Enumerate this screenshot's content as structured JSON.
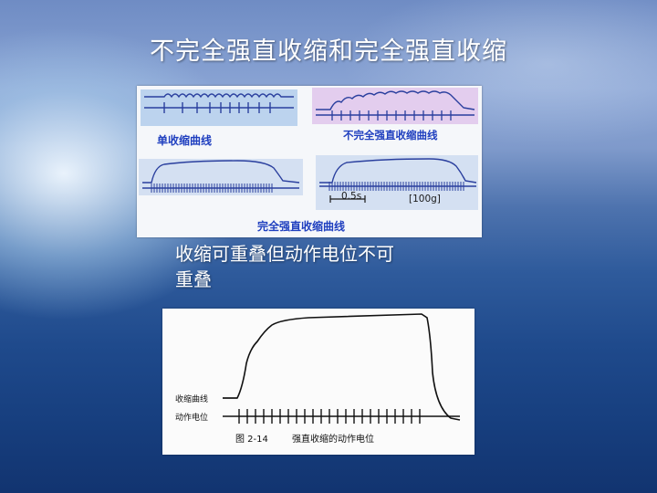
{
  "slide": {
    "title": "不完全强直收缩和完全强直收缩",
    "caption_line1": "收缩可重叠但动作电位不可",
    "caption_line2": "重叠"
  },
  "top_figure": {
    "label_single": "单收缩曲线",
    "label_incomplete": "不完全强直收缩曲线",
    "label_complete": "完全强直收缩曲线",
    "scale_time": "0.5s",
    "scale_force": "[100g]"
  },
  "bottom_figure": {
    "label_contraction": "收缩曲线",
    "label_potential": "动作电位",
    "figure_no": "图  2-14",
    "figure_title": "强直收缩的动作电位"
  },
  "colors": {
    "trace": "#2a3f9e",
    "panel_single": "#bcd3ee",
    "panel_incomplete": "#e3cdee",
    "panel_complete": "#d4e0f2",
    "label_blue": "#1f3fbf"
  }
}
